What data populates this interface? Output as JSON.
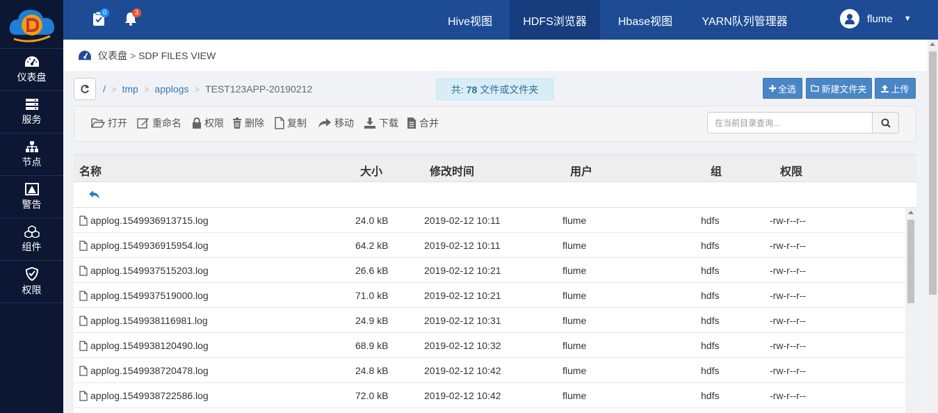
{
  "sidebar": {
    "items": [
      {
        "label": "仪表盘",
        "icon": "dashboard-icon"
      },
      {
        "label": "服务",
        "icon": "server-icon"
      },
      {
        "label": "节点",
        "icon": "sitemap-icon"
      },
      {
        "label": "警告",
        "icon": "warning-icon"
      },
      {
        "label": "组件",
        "icon": "cubes-icon"
      },
      {
        "label": "权限",
        "icon": "shield-icon"
      }
    ]
  },
  "header": {
    "tasks_count": "0",
    "alerts_count": "3",
    "nav": [
      "Hive视图",
      "HDFS浏览器",
      "Hbase视图",
      "YARN队列管理器"
    ],
    "active_nav": "HDFS浏览器",
    "username": "flume"
  },
  "breadcrumb": {
    "home": "仪表盘",
    "sep": ">",
    "current": "SDP FILES VIEW"
  },
  "path": {
    "root": "/",
    "segments": [
      "tmp",
      "applogs"
    ],
    "current": "TEST123APP-20190212",
    "sep": ">"
  },
  "count": {
    "prefix": "共:",
    "value": "78",
    "suffix": "文件或文件夹"
  },
  "buttons": {
    "select_all": "全选",
    "new_folder": "新建文件夹",
    "upload": "上传"
  },
  "toolbar": {
    "open": "打开",
    "rename": "重命名",
    "permission": "权限",
    "delete": "删除",
    "copy": "复制",
    "move": "移动",
    "download": "下载",
    "merge": "合并"
  },
  "search": {
    "placeholder": "在当前目录查询..."
  },
  "table": {
    "headers": {
      "name": "名称",
      "size": "大小",
      "mtime": "修改时间",
      "user": "用户",
      "group": "组",
      "perm": "权限"
    },
    "rows": [
      {
        "name": "applog.1549936913715.log",
        "size": "24.0 kB",
        "mtime": "2019-02-12 10:11",
        "user": "flume",
        "group": "hdfs",
        "perm": "-rw-r--r--"
      },
      {
        "name": "applog.1549936915954.log",
        "size": "64.2 kB",
        "mtime": "2019-02-12 10:11",
        "user": "flume",
        "group": "hdfs",
        "perm": "-rw-r--r--"
      },
      {
        "name": "applog.1549937515203.log",
        "size": "26.6 kB",
        "mtime": "2019-02-12 10:21",
        "user": "flume",
        "group": "hdfs",
        "perm": "-rw-r--r--"
      },
      {
        "name": "applog.1549937519000.log",
        "size": "71.0 kB",
        "mtime": "2019-02-12 10:21",
        "user": "flume",
        "group": "hdfs",
        "perm": "-rw-r--r--"
      },
      {
        "name": "applog.1549938116981.log",
        "size": "24.9 kB",
        "mtime": "2019-02-12 10:31",
        "user": "flume",
        "group": "hdfs",
        "perm": "-rw-r--r--"
      },
      {
        "name": "applog.1549938120490.log",
        "size": "68.9 kB",
        "mtime": "2019-02-12 10:32",
        "user": "flume",
        "group": "hdfs",
        "perm": "-rw-r--r--"
      },
      {
        "name": "applog.1549938720478.log",
        "size": "24.8 kB",
        "mtime": "2019-02-12 10:42",
        "user": "flume",
        "group": "hdfs",
        "perm": "-rw-r--r--"
      },
      {
        "name": "applog.1549938722586.log",
        "size": "72.0 kB",
        "mtime": "2019-02-12 10:42",
        "user": "flume",
        "group": "hdfs",
        "perm": "-rw-r--r--"
      }
    ]
  },
  "colors": {
    "sidebar": "#0b1733",
    "topbar": "#1e4c94",
    "accent": "#4a86c5"
  }
}
